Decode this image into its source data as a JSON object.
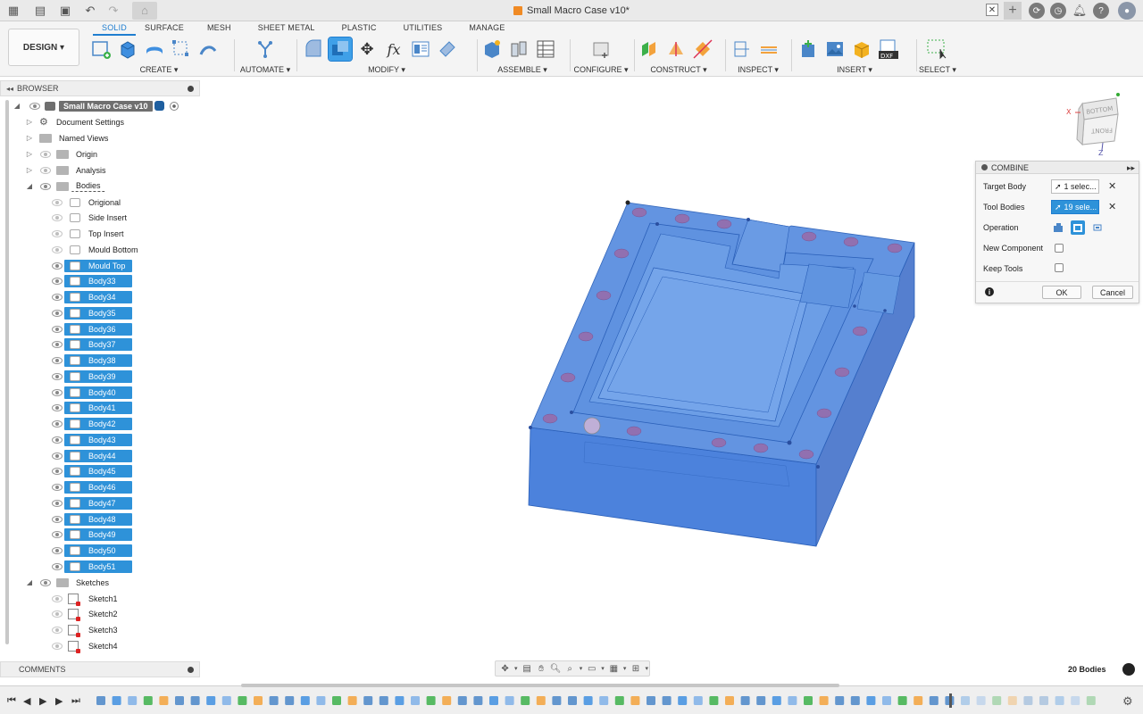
{
  "app": {
    "doc_title": "Small Macro Case v10*"
  },
  "toolbar": {
    "workspace": "DESIGN",
    "tabs": [
      "SOLID",
      "SURFACE",
      "MESH",
      "SHEET METAL",
      "PLASTIC",
      "UTILITIES",
      "MANAGE"
    ],
    "active_tab": "SOLID",
    "groups": {
      "create": "CREATE",
      "automate": "AUTOMATE",
      "modify": "MODIFY",
      "assemble": "ASSEMBLE",
      "configure": "CONFIGURE",
      "construct": "CONSTRUCT",
      "inspect": "INSPECT",
      "insert": "INSERT",
      "select": "SELECT"
    }
  },
  "browser": {
    "title": "BROWSER",
    "root": "Small Macro Case v10",
    "document_settings": "Document Settings",
    "named_views": "Named Views",
    "origin": "Origin",
    "analysis": "Analysis",
    "bodies": "Bodies",
    "body_items": [
      "Origional",
      "Side Insert",
      "Top Insert",
      "Mould Bottom",
      "Mould Top",
      "Body33",
      "Body34",
      "Body35",
      "Body36",
      "Body37",
      "Body38",
      "Body39",
      "Body40",
      "Body41",
      "Body42",
      "Body43",
      "Body44",
      "Body45",
      "Body46",
      "Body47",
      "Body48",
      "Body49",
      "Body50",
      "Body51"
    ],
    "sketches": "Sketches",
    "sketch_items": [
      "Sketch1",
      "Sketch2",
      "Sketch3",
      "Sketch4"
    ]
  },
  "comments": {
    "title": "COMMENTS"
  },
  "combine": {
    "title": "COMBINE",
    "target_label": "Target Body",
    "target_value": "1 selec...",
    "tool_label": "Tool Bodies",
    "tool_value": "19 sele...",
    "operation_label": "Operation",
    "new_component_label": "New Component",
    "keep_tools_label": "Keep Tools",
    "ok_label": "OK",
    "cancel_label": "Cancel"
  },
  "viewcube": {
    "top": "BOTTOM",
    "front": "FRONT",
    "axis_x": "X",
    "axis_z": "Z"
  },
  "status": {
    "bodies_count": "20 Bodies"
  },
  "colors": {
    "accent": "#1f7ed0",
    "selection": "#2e92d9",
    "model": "#5b8fe0"
  }
}
